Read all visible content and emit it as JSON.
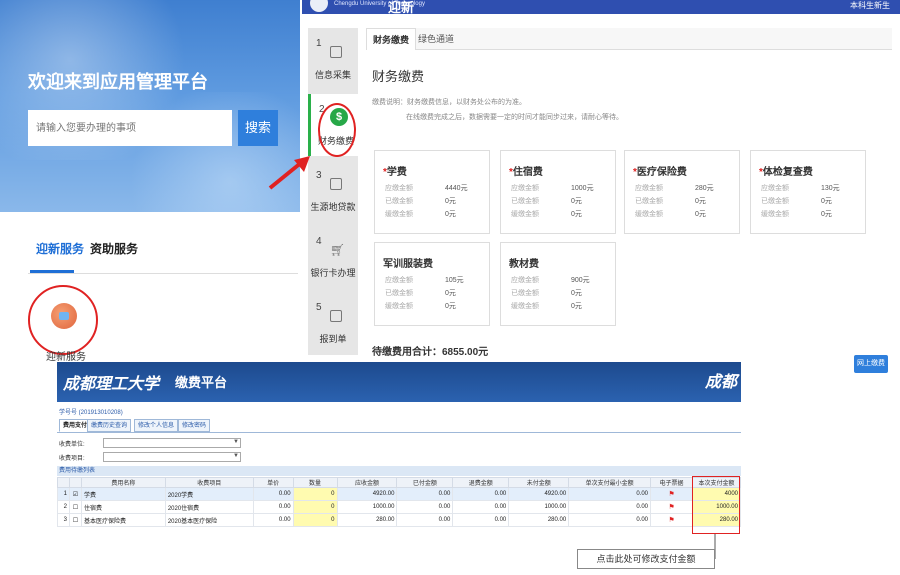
{
  "portal": {
    "welcome": "欢迎来到应用管理平台",
    "search_placeholder": "请输入您要办理的事项",
    "search_button": "搜索",
    "tabs": [
      "迎新服务",
      "资助服务"
    ],
    "service_label": "迎新服务"
  },
  "finance": {
    "header_school": "Chengdu University of Technology",
    "header_title": "迎新",
    "header_user": "本科生新生",
    "steps": [
      {
        "num": "1",
        "label": "信息采集",
        "icon": "form-icon"
      },
      {
        "num": "2",
        "label": "财务缴费",
        "icon": "dollar-icon"
      },
      {
        "num": "3",
        "label": "生源地贷款",
        "icon": "loan-icon"
      },
      {
        "num": "4",
        "label": "银行卡办理",
        "icon": "cart-icon"
      },
      {
        "num": "5",
        "label": "报到单",
        "icon": "document-icon"
      }
    ],
    "tabs": [
      "财务缴费",
      "绿色通道"
    ],
    "title": "财务缴费",
    "note1": "缴费说明：财务缴费信息，以财务处公布的为准。",
    "note2": "在线缴费完成之后，数据需要一定的时间才能同步过来，请耐心等待。",
    "row_labels": [
      "应缴金额",
      "已缴金额",
      "缓缴金额"
    ],
    "fees": [
      {
        "name": "学费",
        "required": true,
        "due": "4440元",
        "paid": "0元",
        "deferred": "0元"
      },
      {
        "name": "住宿费",
        "required": true,
        "due": "1000元",
        "paid": "0元",
        "deferred": "0元"
      },
      {
        "name": "医疗保险费",
        "required": true,
        "due": "280元",
        "paid": "0元",
        "deferred": "0元"
      },
      {
        "name": "体检复查费",
        "required": true,
        "due": "130元",
        "paid": "0元",
        "deferred": "0元"
      },
      {
        "name": "军训服装费",
        "required": false,
        "due": "105元",
        "paid": "0元",
        "deferred": "0元"
      },
      {
        "name": "教材费",
        "required": false,
        "due": "900元",
        "paid": "0元",
        "deferred": "0元"
      }
    ],
    "total": "待缴费用合计：6855.00元",
    "pay_button": "网上缴费"
  },
  "platform": {
    "logo_text": "成都理工大学",
    "title": "缴费平台",
    "user_line": "学号号 (201913010208)",
    "tabs": [
      "费用支付",
      "缴费历史查询",
      "修改个人信息",
      "修改密码"
    ],
    "unit_label": "收费单位:",
    "item_label": "收费项目:",
    "grid_title": "费用待缴列表",
    "columns": [
      "",
      "",
      "费用名称",
      "收费项目",
      "单价",
      "数量",
      "应收金额",
      "已付金额",
      "退费金额",
      "未付金额",
      "单次支付最小金额",
      "电子票据",
      "本次支付金额"
    ],
    "rows": [
      {
        "idx": "1",
        "checked": true,
        "name": "学费",
        "item": "2020学费",
        "price": "0.00",
        "qty": "0",
        "receivable": "4920.00",
        "paid": "0.00",
        "refund": "0.00",
        "unpaid": "4920.00",
        "min": "0.00",
        "pay": "4000"
      },
      {
        "idx": "2",
        "checked": false,
        "name": "住宿费",
        "item": "2020住宿费",
        "price": "0.00",
        "qty": "0",
        "receivable": "1000.00",
        "paid": "0.00",
        "refund": "0.00",
        "unpaid": "1000.00",
        "min": "0.00",
        "pay": "1000.00"
      },
      {
        "idx": "3",
        "checked": false,
        "name": "基本医疗保险费",
        "item": "2020基本医疗保险",
        "price": "0.00",
        "qty": "0",
        "receivable": "280.00",
        "paid": "0.00",
        "refund": "0.00",
        "unpaid": "280.00",
        "min": "0.00",
        "pay": "280.00"
      }
    ],
    "hint": "点击此处可修改支付金额"
  },
  "colors": {
    "primary_blue": "#2f7fdc",
    "header_blue": "#2f4fb0",
    "highlight_red": "#e02222",
    "step_green": "#27a848",
    "pay_yellow": "#fffbb0"
  }
}
